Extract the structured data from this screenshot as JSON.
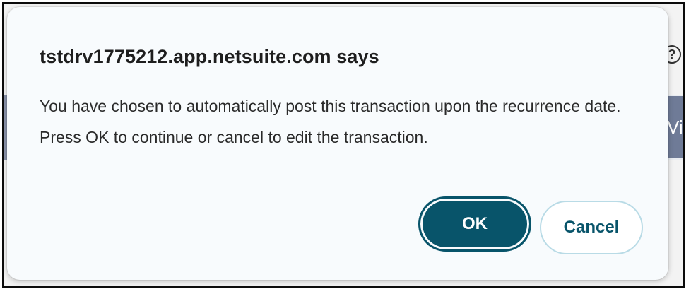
{
  "background": {
    "help_icon_glyph": "?",
    "right_panel_text": "Vi"
  },
  "dialog": {
    "title": "tstdrv1775212.app.netsuite.com says",
    "message": "You have chosen to automatically post this transaction upon the recurrence date. Press OK to continue or cancel to edit the transaction.",
    "ok_label": "OK",
    "cancel_label": "Cancel"
  },
  "colors": {
    "primary": "#08546a",
    "cancel_border": "#b9dbe6",
    "dialog_bg": "#f8fbfd"
  }
}
